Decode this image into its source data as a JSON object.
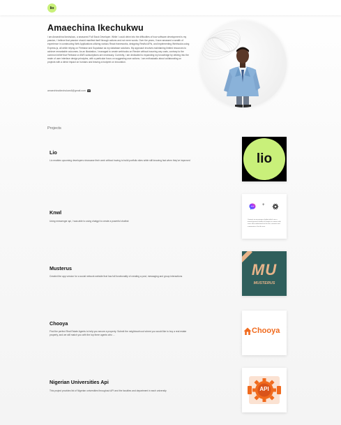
{
  "header": {
    "logo_text": "lio"
  },
  "hero": {
    "name": "Amaechina Ikechukwu",
    "bio": "I am Amaechina Ikechukwu, a seasoned Full Stack Developer. While I could delve into the difficulties of how software development is my passion, I believe that passion should manifest itself through actions and not mere words. Over the years, I have amassed a wealth of experience in constructing Web Applications utilizing various React frameworks, designing Restful APIs, and implementing Webhooks using Express.js, all while relying on Firebase and Supabase as my database solutions. My approach involves maintaining limited resources to achieve remarkable outcomes. As an illustration, I managed to create webhooks on Render without incurring any costs, contrary to the common belief that Firebase or AWS subscriptions are necessary. Currently, I am dedicated to expanding my knowledge by delving into the realm of user interface design principles, with a particular focus on suggesting user actions. I am enthusiastic about collaborating on projects with a direct impact on humans and leaving a footprint on innovation.",
    "email": "amaechinaikechukwu6@gmail.com",
    "email_icon": "mail-icon"
  },
  "projects_label": "Projects",
  "projects": [
    {
      "title": "Lio",
      "description": "Lio enables upcoming developers showcase their work without having to build portfolio sites while still knowing fact when they've improved",
      "thumb_text": "lio"
    },
    {
      "title": "Knwl",
      "description": "Using messenger api, I was able to using chatgpt to create a powerful chatbot",
      "thumb_plus": "+",
      "thumb_caption": "Connect on messenger chatbot which use a trained general chatbot of Google to connect with users who understand via the text, converts and summarizes it for the user."
    },
    {
      "title": "Musterus",
      "description": "Created the app version for a social network website that has full functionality of creating a post, messaging and group interactions",
      "thumb_text": "MU",
      "thumb_sub": "MUSTERUS"
    },
    {
      "title": "Chooya",
      "description": "Find the perfect Real Estate Agents to help you secure a property. Submit the neighbourhood where you would like to buy a real estate property, and we will match you with the top three agents who ...",
      "thumb_text": "Chooya"
    },
    {
      "title": "Nigerian Universities Api",
      "description": "This project provides list of Nigerian universities throughout API and the faculties and department in each university",
      "thumb_text": "API"
    }
  ],
  "colors": {
    "lime": "#c9f07a",
    "musterus_bg": "#2f5f5c",
    "musterus_text": "#e8b48a",
    "chooya_orange": "#f06a1d",
    "api_orange": "#f06a1d"
  }
}
